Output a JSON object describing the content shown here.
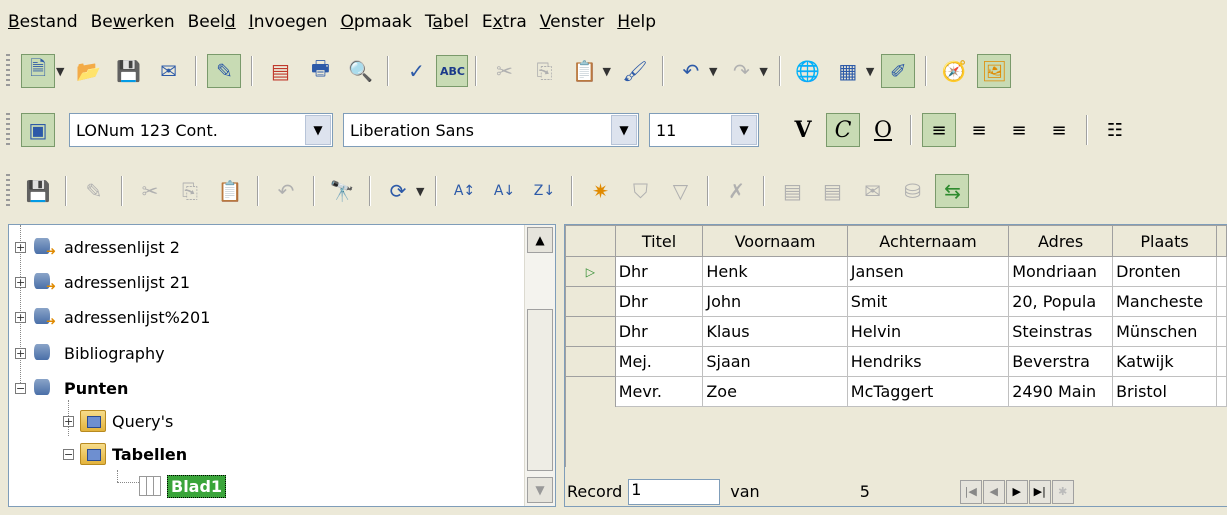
{
  "menu": [
    {
      "label": "Bestand",
      "u": "B",
      "pre": "",
      "post": "estand"
    },
    {
      "label": "Bewerken",
      "pre": "Be",
      "u": "w",
      "post": "erken"
    },
    {
      "label": "Beeld",
      "pre": "Beel",
      "u": "d",
      "post": ""
    },
    {
      "label": "Invoegen",
      "pre": "",
      "u": "I",
      "post": "nvoegen"
    },
    {
      "label": "Opmaak",
      "pre": "",
      "u": "O",
      "post": "pmaak"
    },
    {
      "label": "Tabel",
      "pre": "T",
      "u": "a",
      "post": "bel"
    },
    {
      "label": "Extra",
      "pre": "E",
      "u": "x",
      "post": "tra"
    },
    {
      "label": "Venster",
      "pre": "",
      "u": "V",
      "post": "enster"
    },
    {
      "label": "Help",
      "pre": "",
      "u": "H",
      "post": "elp"
    }
  ],
  "format_bar": {
    "style_value": "LONum 123 Cont.",
    "font_value": "Liberation Sans",
    "size_value": "11",
    "bold_glyph": "V",
    "italic_glyph": "C",
    "underline_glyph": "O"
  },
  "tree": {
    "items": [
      {
        "label": "adressenlijst 2",
        "expander": "+"
      },
      {
        "label": "adressenlijst 21",
        "expander": "+"
      },
      {
        "label": "adressenlijst%201",
        "expander": "+"
      },
      {
        "label": "Bibliography",
        "expander": "+"
      },
      {
        "label": "Punten",
        "expander": "−"
      },
      {
        "label": "Query's",
        "expander": "+"
      },
      {
        "label": "Tabellen",
        "expander": "−"
      },
      {
        "label": "Blad1"
      }
    ]
  },
  "grid": {
    "columns": [
      "Titel",
      "Voornaam",
      "Achternaam",
      "Adres",
      "Plaats"
    ],
    "rows": [
      [
        "Dhr",
        "Henk",
        "Jansen",
        "Mondriaan",
        "Dronten"
      ],
      [
        "Dhr",
        "John",
        "Smit",
        "20, Popula",
        "Mancheste"
      ],
      [
        "Dhr",
        "Klaus",
        "Helvin",
        "Steinstras",
        "Münschen"
      ],
      [
        "Mej.",
        "Sjaan",
        "Hendriks",
        "Beverstra",
        "Katwijk"
      ],
      [
        "Mevr.",
        "Zoe",
        "McTaggert",
        "2490 Main",
        "Bristol"
      ]
    ],
    "current_marker": "▷"
  },
  "record_bar": {
    "record_label": "Record",
    "record_value": "1",
    "of_label": "van",
    "total": "5"
  }
}
